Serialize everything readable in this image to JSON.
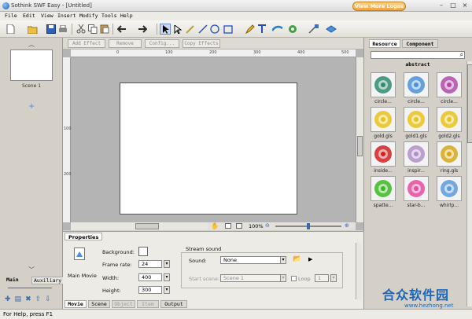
{
  "window": {
    "title": "Sothink SWF Easy - [Untitled]",
    "promo_button": "View More Logos",
    "min_glyph": "–",
    "max_glyph": "□",
    "close_glyph": "×"
  },
  "menu": [
    "File",
    "Edit",
    "View",
    "Insert",
    "Modify",
    "Tools",
    "Help"
  ],
  "toolbar": {
    "icons": [
      "new-icon",
      "open-icon",
      "save-icon",
      "print-icon",
      "cut-icon",
      "copy-icon",
      "paste-icon",
      "undo-icon",
      "redo-icon",
      "select-arrow-icon",
      "subselect-icon",
      "line-icon",
      "pen-icon",
      "ellipse-icon",
      "rectangle-icon",
      "pencil-icon",
      "text-icon",
      "brush-icon",
      "paint-icon",
      "fill-icon",
      "transform-icon",
      "eraser-icon"
    ]
  },
  "effectbar": {
    "add_effect": "Add Effect",
    "remove": "Remove",
    "config": "Config...",
    "copy_effects": "Copy Effects"
  },
  "scene_panel": {
    "scene_label": "Scene 1",
    "add_glyph": "+",
    "tabs": [
      "Main",
      "Auxiliary"
    ]
  },
  "ruler": {
    "top": [
      "0",
      "100",
      "200",
      "300",
      "400",
      "500"
    ],
    "left": [
      "100",
      "200"
    ]
  },
  "zoom": {
    "value": "100%",
    "fraction": 0.5
  },
  "resource": {
    "tabs": [
      "Resource",
      "Component"
    ],
    "category": "abstract",
    "items": [
      {
        "label": "circle...",
        "color": "#2e8b6f"
      },
      {
        "label": "circle...",
        "color": "#4a90d9"
      },
      {
        "label": "circle...",
        "color": "#b04aa8"
      },
      {
        "label": "gold.gls",
        "color": "#e8c21a"
      },
      {
        "label": "gold1.gls",
        "color": "#e8c21a"
      },
      {
        "label": "gold2.gls",
        "color": "#e8c21a"
      },
      {
        "label": "inside...",
        "color": "#d42020"
      },
      {
        "label": "inspir...",
        "color": "#b090c8"
      },
      {
        "label": "ring.gls",
        "color": "#d4a81a"
      },
      {
        "label": "spatte...",
        "color": "#3ab820"
      },
      {
        "label": "star-b...",
        "color": "#e84aa0"
      },
      {
        "label": "whirlp...",
        "color": "#5a9ad8"
      }
    ]
  },
  "properties": {
    "tab": "Properties",
    "movie_label": "Main Movie",
    "background_label": "Background:",
    "frame_rate_label": "Frame rate:",
    "frame_rate": "24",
    "width_label": "Width:",
    "width": "400",
    "height_label": "Height:",
    "height": "300",
    "stream_title": "Stream sound",
    "sound_label": "Sound:",
    "sound_value": "None",
    "start_scene_label": "Start scene:",
    "start_scene_value": "Scene 1",
    "loop_label": "Loop",
    "loop_value": "1"
  },
  "bottom_tabs": [
    "Movie",
    "Scene",
    "Object",
    "Item",
    "Output"
  ],
  "status": "For Help, press F1",
  "watermark": {
    "text": "合众软件园",
    "url": "www.hezhong.net"
  }
}
